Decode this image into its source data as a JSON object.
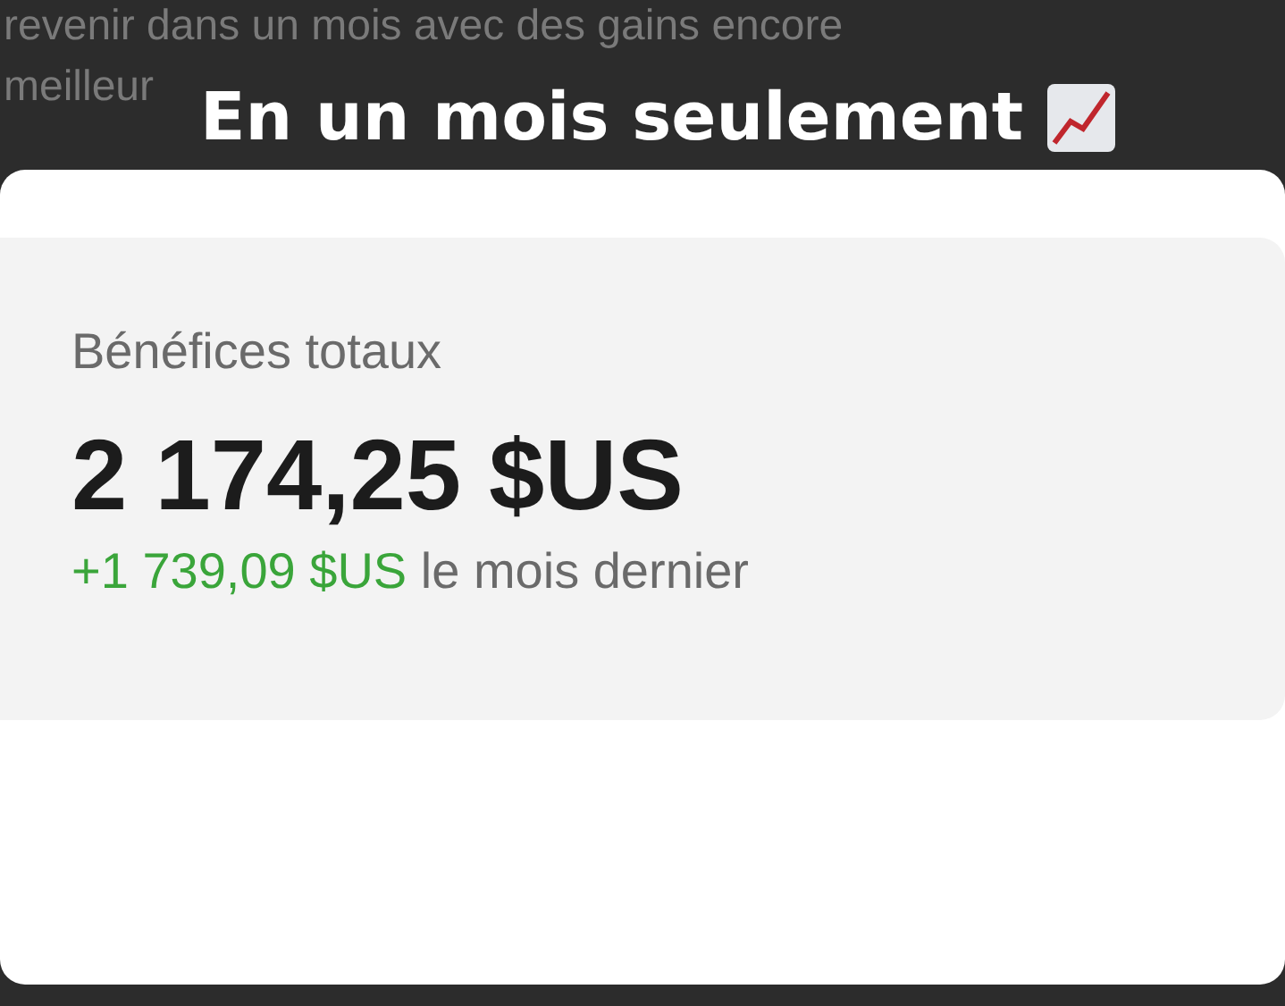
{
  "background_text": [
    "revenir dans un mois avec des gains encore",
    "meilleur"
  ],
  "caption": "En un mois seulement",
  "card": {
    "label": "Bénéfices totaux",
    "total": "2 174,25 $US",
    "change": "+1 739,09 $US",
    "change_suffix": "le mois dernier"
  }
}
